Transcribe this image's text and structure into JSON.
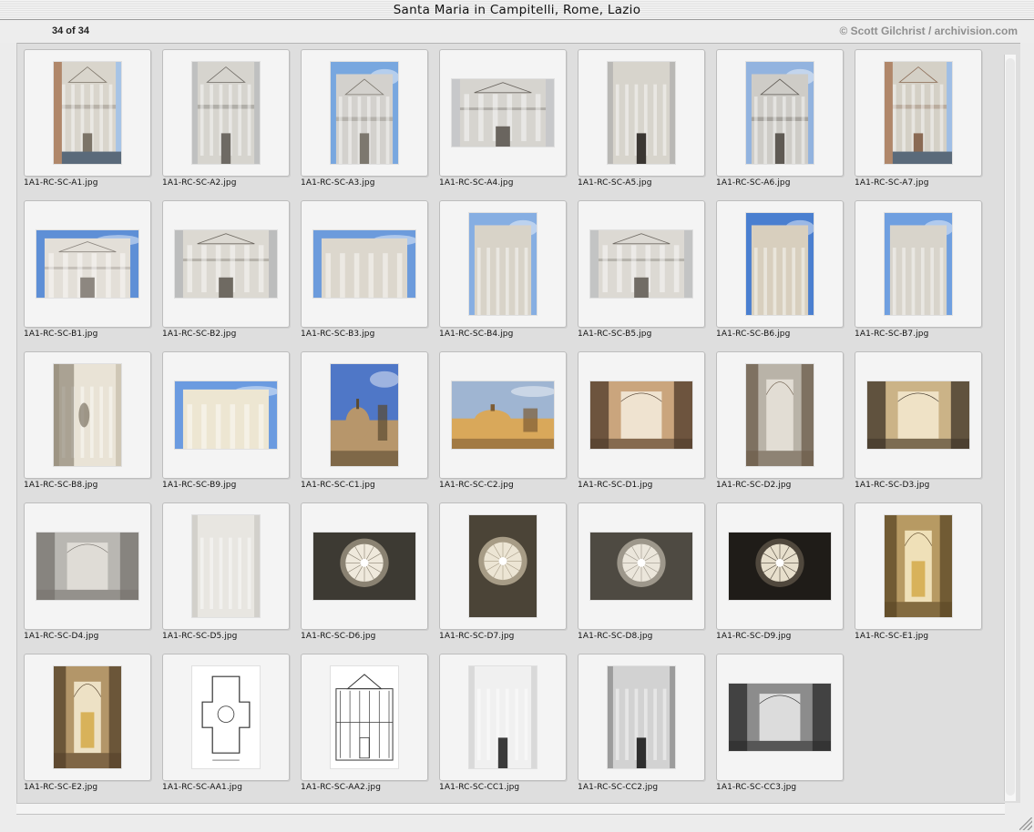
{
  "window": {
    "title": "Santa Maria in Campitelli, Rome, Lazio"
  },
  "header": {
    "count": "34 of 34",
    "credit": "© Scott Gilchrist / archivision.com"
  },
  "thumbnails": [
    {
      "file": "1A1-RC-SC-A1.jpg",
      "kind": "facade-street",
      "orient": "portrait",
      "colors": [
        "#a7c4e6",
        "#d9d5cc",
        "#7c7468"
      ]
    },
    {
      "file": "1A1-RC-SC-A2.jpg",
      "kind": "facade",
      "orient": "portrait",
      "colors": [
        "#bfc0c0",
        "#d6d4ce",
        "#6e6a64"
      ]
    },
    {
      "file": "1A1-RC-SC-A3.jpg",
      "kind": "facade-sky",
      "orient": "portrait",
      "colors": [
        "#78a7df",
        "#d3d1cd",
        "#7d786f"
      ]
    },
    {
      "file": "1A1-RC-SC-A4.jpg",
      "kind": "facade",
      "orient": "landscape",
      "colors": [
        "#c7c8ca",
        "#d6d4cf",
        "#6a655f"
      ]
    },
    {
      "file": "1A1-RC-SC-A5.jpg",
      "kind": "portal",
      "orient": "portrait",
      "colors": [
        "#b9b8b5",
        "#d7d4cc",
        "#3a3632"
      ]
    },
    {
      "file": "1A1-RC-SC-A6.jpg",
      "kind": "facade-sky",
      "orient": "portrait",
      "colors": [
        "#92b3df",
        "#ceccc7",
        "#5f5a54"
      ]
    },
    {
      "file": "1A1-RC-SC-A7.jpg",
      "kind": "facade-street",
      "orient": "portrait",
      "colors": [
        "#9fbee5",
        "#d4d0c6",
        "#8a6a54"
      ]
    },
    {
      "file": "1A1-RC-SC-B1.jpg",
      "kind": "facade-sky",
      "orient": "landscape",
      "colors": [
        "#5e8fd6",
        "#e3dfd8",
        "#8d8780"
      ]
    },
    {
      "file": "1A1-RC-SC-B2.jpg",
      "kind": "pediment",
      "orient": "landscape",
      "colors": [
        "#bcbdbd",
        "#dcd9d2",
        "#6f6a62"
      ]
    },
    {
      "file": "1A1-RC-SC-B3.jpg",
      "kind": "columns-sky",
      "orient": "landscape",
      "colors": [
        "#6c9bdc",
        "#dcd7cd",
        "#8a8379"
      ]
    },
    {
      "file": "1A1-RC-SC-B4.jpg",
      "kind": "columns-sky",
      "orient": "portrait",
      "colors": [
        "#86aee2",
        "#d8d3c8",
        "#857c70"
      ]
    },
    {
      "file": "1A1-RC-SC-B5.jpg",
      "kind": "pediment",
      "orient": "landscape",
      "colors": [
        "#c3c4c4",
        "#dcd9d3",
        "#716c65"
      ]
    },
    {
      "file": "1A1-RC-SC-B6.jpg",
      "kind": "columns-sky",
      "orient": "portrait",
      "colors": [
        "#4a7fd0",
        "#d8cfbe",
        "#7b6a55"
      ]
    },
    {
      "file": "1A1-RC-SC-B7.jpg",
      "kind": "columns-sky",
      "orient": "portrait",
      "colors": [
        "#6f9fe0",
        "#d8d4cb",
        "#7c766c"
      ]
    },
    {
      "file": "1A1-RC-SC-B8.jpg",
      "kind": "detail",
      "orient": "portrait",
      "colors": [
        "#cfc7b6",
        "#e9e3d6",
        "#6b6150"
      ]
    },
    {
      "file": "1A1-RC-SC-B9.jpg",
      "kind": "columns-sky",
      "orient": "landscape",
      "colors": [
        "#6b9be0",
        "#ede6d2",
        "#9b8e72"
      ]
    },
    {
      "file": "1A1-RC-SC-C1.jpg",
      "kind": "dome-sky",
      "orient": "portrait",
      "colors": [
        "#4f77c7",
        "#b7966b",
        "#5a4a30"
      ]
    },
    {
      "file": "1A1-RC-SC-C2.jpg",
      "kind": "dome-sky",
      "orient": "landscape",
      "colors": [
        "#9fb5d2",
        "#d9a85a",
        "#7d5c34"
      ]
    },
    {
      "file": "1A1-RC-SC-D1.jpg",
      "kind": "interior",
      "orient": "landscape",
      "colors": [
        "#caa57d",
        "#efe3d0",
        "#4d3a2a"
      ]
    },
    {
      "file": "1A1-RC-SC-D2.jpg",
      "kind": "interior",
      "orient": "portrait",
      "colors": [
        "#b9b3a8",
        "#e2ddd4",
        "#6b5b49"
      ]
    },
    {
      "file": "1A1-RC-SC-D3.jpg",
      "kind": "interior",
      "orient": "landscape",
      "colors": [
        "#cbb387",
        "#efe2c6",
        "#3c3226"
      ]
    },
    {
      "file": "1A1-RC-SC-D4.jpg",
      "kind": "ceiling",
      "orient": "landscape",
      "colors": [
        "#b9b7b2",
        "#dfdcd6",
        "#77736d"
      ]
    },
    {
      "file": "1A1-RC-SC-D5.jpg",
      "kind": "columns",
      "orient": "portrait",
      "colors": [
        "#d2d0cb",
        "#e8e6e1",
        "#8d897f"
      ]
    },
    {
      "file": "1A1-RC-SC-D6.jpg",
      "kind": "dome-interior",
      "orient": "landscape",
      "colors": [
        "#8a8272",
        "#efe9dc",
        "#3d3a33"
      ]
    },
    {
      "file": "1A1-RC-SC-D7.jpg",
      "kind": "dome-interior",
      "orient": "portrait",
      "colors": [
        "#a79c86",
        "#ece5d4",
        "#4b4437"
      ]
    },
    {
      "file": "1A1-RC-SC-D8.jpg",
      "kind": "dome-interior",
      "orient": "landscape",
      "colors": [
        "#9d978b",
        "#ebe6db",
        "#4e4a42"
      ]
    },
    {
      "file": "1A1-RC-SC-D9.jpg",
      "kind": "dome-interior",
      "orient": "landscape",
      "colors": [
        "#50483d",
        "#e7dfcc",
        "#1f1c18"
      ]
    },
    {
      "file": "1A1-RC-SC-E1.jpg",
      "kind": "altar",
      "orient": "portrait",
      "colors": [
        "#b79a63",
        "#efe0b8",
        "#5a4524"
      ]
    },
    {
      "file": "1A1-RC-SC-E2.jpg",
      "kind": "altar",
      "orient": "portrait",
      "colors": [
        "#b39669",
        "#ede1c5",
        "#53402a"
      ]
    },
    {
      "file": "1A1-RC-SC-AA1.jpg",
      "kind": "plan-drawing",
      "orient": "portrait",
      "colors": [
        "#f2f1ee",
        "#ffffff",
        "#333333"
      ]
    },
    {
      "file": "1A1-RC-SC-AA2.jpg",
      "kind": "elevation-drawing",
      "orient": "portrait",
      "colors": [
        "#efeeeb",
        "#ffffff",
        "#3a3a3a"
      ]
    },
    {
      "file": "1A1-RC-SC-CC1.jpg",
      "kind": "bw-photo",
      "orient": "portrait",
      "colors": [
        "#d9d9d9",
        "#f0f0f0",
        "#3b3b3b"
      ]
    },
    {
      "file": "1A1-RC-SC-CC2.jpg",
      "kind": "bw-photo",
      "orient": "portrait",
      "colors": [
        "#9c9c9c",
        "#d2d2d2",
        "#2e2e2e"
      ]
    },
    {
      "file": "1A1-RC-SC-CC3.jpg",
      "kind": "bw-interior",
      "orient": "landscape",
      "colors": [
        "#8c8c8c",
        "#dcdcdc",
        "#2a2a2a"
      ]
    }
  ]
}
